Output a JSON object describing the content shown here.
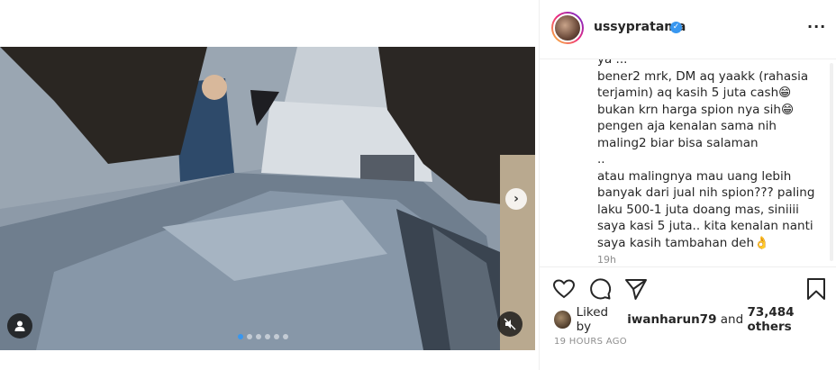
{
  "post": {
    "username": "ussypratama",
    "verified_mark": "✓",
    "more_label": "···",
    "caption": "ya ... \nbener2 mrk, DM aq yaakk (rahasia terjamin) aq kasih 5 juta cash😁\nbukan krn harga spion nya sih😁\npengen aja kenalan sama nih maling2 biar bisa salaman\n..\natau malingnya mau uang lebih banyak dari jual nih spion??? paling laku 500-1 juta doang mas, siniiii saya kasi 5 juta.. kita kenalan nanti saya kasih tambahan deh👌",
    "caption_time": "19h",
    "liked_prefix": "Liked by",
    "liked_user": "iwanharun79",
    "liked_and": "and",
    "likes_count": "73,484 others",
    "posted_time": "19 HOURS AGO"
  },
  "media": {
    "next_arrow": "›",
    "carousel_count": 6,
    "carousel_active": 1
  },
  "icons": [
    "user-tag-icon",
    "mute-icon",
    "heart-icon",
    "comment-icon",
    "share-icon",
    "bookmark-icon",
    "verified-icon",
    "more-icon"
  ],
  "colors": {
    "accent": "#3897f0",
    "text": "#262626",
    "muted": "#8e8e8e"
  }
}
